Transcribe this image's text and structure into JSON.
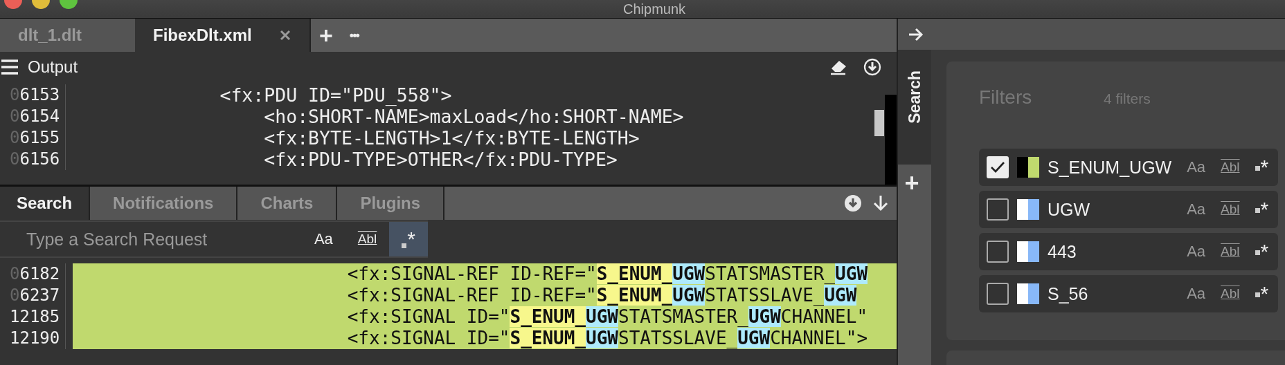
{
  "window": {
    "title": "Chipmunk"
  },
  "file_tabs": [
    {
      "label": "dlt_1.dlt",
      "selected": false,
      "closable": false
    },
    {
      "label": "FibexDlt.xml",
      "selected": true,
      "closable": true
    }
  ],
  "file_tab_actions": {
    "add": "+",
    "more": "•••"
  },
  "output": {
    "title": "Output",
    "lines": [
      {
        "leading_zero": "0",
        "number": "6153",
        "text": "            <fx:PDU ID=\"PDU_558\">"
      },
      {
        "leading_zero": "0",
        "number": "6154",
        "text": "                <ho:SHORT-NAME>maxLoad</ho:SHORT-NAME>"
      },
      {
        "leading_zero": "0",
        "number": "6155",
        "text": "                <fx:BYTE-LENGTH>1</fx:BYTE-LENGTH>"
      },
      {
        "leading_zero": "0",
        "number": "6156",
        "text": "                <fx:PDU-TYPE>OTHER</fx:PDU-TYPE>"
      }
    ]
  },
  "bottom_tabs": [
    {
      "label": "Search",
      "selected": true
    },
    {
      "label": "Notifications",
      "selected": false
    },
    {
      "label": "Charts",
      "selected": false
    },
    {
      "label": "Plugins",
      "selected": false
    }
  ],
  "search": {
    "placeholder": "Type a Search Request",
    "options": [
      {
        "kind": "case",
        "label": "Aa",
        "selected": false
      },
      {
        "kind": "word",
        "label": "Abl",
        "selected": false
      },
      {
        "kind": "regex",
        "label": "*",
        "selected": true
      }
    ]
  },
  "results": [
    {
      "leading_zero": "0",
      "number": "6182",
      "segments": [
        {
          "text": "                        <fx:SIGNAL-REF ID-REF=\""
        },
        {
          "text": "S_ENUM_",
          "color": "#f7f78c"
        },
        {
          "text": "UGW",
          "color": "#aeeafc"
        },
        {
          "text": "STATSMASTER_"
        },
        {
          "text": "UGW",
          "color": "#aeeafc"
        }
      ]
    },
    {
      "leading_zero": "0",
      "number": "6237",
      "segments": [
        {
          "text": "                        <fx:SIGNAL-REF ID-REF=\""
        },
        {
          "text": "S_ENUM_",
          "color": "#f7f78c"
        },
        {
          "text": "UGW",
          "color": "#aeeafc"
        },
        {
          "text": "STATSSLAVE_"
        },
        {
          "text": "UGW",
          "color": "#aeeafc"
        }
      ]
    },
    {
      "number": "12185",
      "segments": [
        {
          "text": "                        <fx:SIGNAL ID=\""
        },
        {
          "text": "S_ENUM_",
          "color": "#f7f78c"
        },
        {
          "text": "UGW",
          "color": "#aeeafc"
        },
        {
          "text": "STATSMASTER_"
        },
        {
          "text": "UGW",
          "color": "#aeeafc"
        },
        {
          "text": "CHANNEL\""
        }
      ]
    },
    {
      "number": "12190",
      "segments": [
        {
          "text": "                        <fx:SIGNAL ID=\""
        },
        {
          "text": "S_ENUM_",
          "color": "#f7f78c"
        },
        {
          "text": "UGW",
          "color": "#aeeafc"
        },
        {
          "text": "STATSSLAVE_"
        },
        {
          "text": "UGW",
          "color": "#aeeafc"
        },
        {
          "text": "CHANNEL\">"
        }
      ]
    }
  ],
  "sidebar": {
    "tab": "Search",
    "add": "+",
    "filters_title": "Filters",
    "filters_count": "4 filters",
    "filters": [
      {
        "name": "S_ENUM_UGW",
        "checked": true,
        "swatch": [
          {
            "color": "#000000"
          },
          {
            "color": "#c0d96e"
          }
        ],
        "options": [
          "Aa",
          "Abl",
          "*"
        ]
      },
      {
        "name": "UGW",
        "checked": false,
        "swatch": [
          {
            "color": "#ffffff"
          },
          {
            "color": "#88b8f8"
          }
        ],
        "options": [
          "Aa",
          "Abl",
          "*"
        ]
      },
      {
        "name": "443",
        "checked": false,
        "swatch": [
          {
            "color": "#ffffff"
          },
          {
            "color": "#88b8f8"
          }
        ],
        "options": [
          "Aa",
          "Abl",
          "*"
        ]
      },
      {
        "name": "S_56",
        "checked": false,
        "swatch": [
          {
            "color": "#ffffff"
          },
          {
            "color": "#88b8f8"
          }
        ],
        "options": [
          "Aa",
          "Abl",
          "*"
        ]
      }
    ]
  }
}
